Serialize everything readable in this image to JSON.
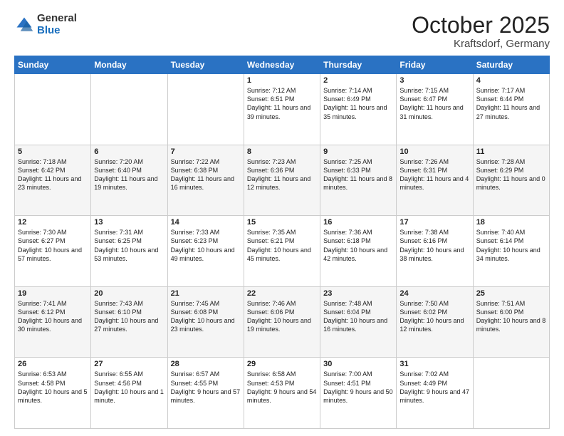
{
  "header": {
    "logo_general": "General",
    "logo_blue": "Blue",
    "month_title": "October 2025",
    "location": "Kraftsdorf, Germany"
  },
  "days_of_week": [
    "Sunday",
    "Monday",
    "Tuesday",
    "Wednesday",
    "Thursday",
    "Friday",
    "Saturday"
  ],
  "weeks": [
    [
      {
        "day": "",
        "sunrise": "",
        "sunset": "",
        "daylight": ""
      },
      {
        "day": "",
        "sunrise": "",
        "sunset": "",
        "daylight": ""
      },
      {
        "day": "",
        "sunrise": "",
        "sunset": "",
        "daylight": ""
      },
      {
        "day": "1",
        "sunrise": "Sunrise: 7:12 AM",
        "sunset": "Sunset: 6:51 PM",
        "daylight": "Daylight: 11 hours and 39 minutes."
      },
      {
        "day": "2",
        "sunrise": "Sunrise: 7:14 AM",
        "sunset": "Sunset: 6:49 PM",
        "daylight": "Daylight: 11 hours and 35 minutes."
      },
      {
        "day": "3",
        "sunrise": "Sunrise: 7:15 AM",
        "sunset": "Sunset: 6:47 PM",
        "daylight": "Daylight: 11 hours and 31 minutes."
      },
      {
        "day": "4",
        "sunrise": "Sunrise: 7:17 AM",
        "sunset": "Sunset: 6:44 PM",
        "daylight": "Daylight: 11 hours and 27 minutes."
      }
    ],
    [
      {
        "day": "5",
        "sunrise": "Sunrise: 7:18 AM",
        "sunset": "Sunset: 6:42 PM",
        "daylight": "Daylight: 11 hours and 23 minutes."
      },
      {
        "day": "6",
        "sunrise": "Sunrise: 7:20 AM",
        "sunset": "Sunset: 6:40 PM",
        "daylight": "Daylight: 11 hours and 19 minutes."
      },
      {
        "day": "7",
        "sunrise": "Sunrise: 7:22 AM",
        "sunset": "Sunset: 6:38 PM",
        "daylight": "Daylight: 11 hours and 16 minutes."
      },
      {
        "day": "8",
        "sunrise": "Sunrise: 7:23 AM",
        "sunset": "Sunset: 6:36 PM",
        "daylight": "Daylight: 11 hours and 12 minutes."
      },
      {
        "day": "9",
        "sunrise": "Sunrise: 7:25 AM",
        "sunset": "Sunset: 6:33 PM",
        "daylight": "Daylight: 11 hours and 8 minutes."
      },
      {
        "day": "10",
        "sunrise": "Sunrise: 7:26 AM",
        "sunset": "Sunset: 6:31 PM",
        "daylight": "Daylight: 11 hours and 4 minutes."
      },
      {
        "day": "11",
        "sunrise": "Sunrise: 7:28 AM",
        "sunset": "Sunset: 6:29 PM",
        "daylight": "Daylight: 11 hours and 0 minutes."
      }
    ],
    [
      {
        "day": "12",
        "sunrise": "Sunrise: 7:30 AM",
        "sunset": "Sunset: 6:27 PM",
        "daylight": "Daylight: 10 hours and 57 minutes."
      },
      {
        "day": "13",
        "sunrise": "Sunrise: 7:31 AM",
        "sunset": "Sunset: 6:25 PM",
        "daylight": "Daylight: 10 hours and 53 minutes."
      },
      {
        "day": "14",
        "sunrise": "Sunrise: 7:33 AM",
        "sunset": "Sunset: 6:23 PM",
        "daylight": "Daylight: 10 hours and 49 minutes."
      },
      {
        "day": "15",
        "sunrise": "Sunrise: 7:35 AM",
        "sunset": "Sunset: 6:21 PM",
        "daylight": "Daylight: 10 hours and 45 minutes."
      },
      {
        "day": "16",
        "sunrise": "Sunrise: 7:36 AM",
        "sunset": "Sunset: 6:18 PM",
        "daylight": "Daylight: 10 hours and 42 minutes."
      },
      {
        "day": "17",
        "sunrise": "Sunrise: 7:38 AM",
        "sunset": "Sunset: 6:16 PM",
        "daylight": "Daylight: 10 hours and 38 minutes."
      },
      {
        "day": "18",
        "sunrise": "Sunrise: 7:40 AM",
        "sunset": "Sunset: 6:14 PM",
        "daylight": "Daylight: 10 hours and 34 minutes."
      }
    ],
    [
      {
        "day": "19",
        "sunrise": "Sunrise: 7:41 AM",
        "sunset": "Sunset: 6:12 PM",
        "daylight": "Daylight: 10 hours and 30 minutes."
      },
      {
        "day": "20",
        "sunrise": "Sunrise: 7:43 AM",
        "sunset": "Sunset: 6:10 PM",
        "daylight": "Daylight: 10 hours and 27 minutes."
      },
      {
        "day": "21",
        "sunrise": "Sunrise: 7:45 AM",
        "sunset": "Sunset: 6:08 PM",
        "daylight": "Daylight: 10 hours and 23 minutes."
      },
      {
        "day": "22",
        "sunrise": "Sunrise: 7:46 AM",
        "sunset": "Sunset: 6:06 PM",
        "daylight": "Daylight: 10 hours and 19 minutes."
      },
      {
        "day": "23",
        "sunrise": "Sunrise: 7:48 AM",
        "sunset": "Sunset: 6:04 PM",
        "daylight": "Daylight: 10 hours and 16 minutes."
      },
      {
        "day": "24",
        "sunrise": "Sunrise: 7:50 AM",
        "sunset": "Sunset: 6:02 PM",
        "daylight": "Daylight: 10 hours and 12 minutes."
      },
      {
        "day": "25",
        "sunrise": "Sunrise: 7:51 AM",
        "sunset": "Sunset: 6:00 PM",
        "daylight": "Daylight: 10 hours and 8 minutes."
      }
    ],
    [
      {
        "day": "26",
        "sunrise": "Sunrise: 6:53 AM",
        "sunset": "Sunset: 4:58 PM",
        "daylight": "Daylight: 10 hours and 5 minutes."
      },
      {
        "day": "27",
        "sunrise": "Sunrise: 6:55 AM",
        "sunset": "Sunset: 4:56 PM",
        "daylight": "Daylight: 10 hours and 1 minute."
      },
      {
        "day": "28",
        "sunrise": "Sunrise: 6:57 AM",
        "sunset": "Sunset: 4:55 PM",
        "daylight": "Daylight: 9 hours and 57 minutes."
      },
      {
        "day": "29",
        "sunrise": "Sunrise: 6:58 AM",
        "sunset": "Sunset: 4:53 PM",
        "daylight": "Daylight: 9 hours and 54 minutes."
      },
      {
        "day": "30",
        "sunrise": "Sunrise: 7:00 AM",
        "sunset": "Sunset: 4:51 PM",
        "daylight": "Daylight: 9 hours and 50 minutes."
      },
      {
        "day": "31",
        "sunrise": "Sunrise: 7:02 AM",
        "sunset": "Sunset: 4:49 PM",
        "daylight": "Daylight: 9 hours and 47 minutes."
      },
      {
        "day": "",
        "sunrise": "",
        "sunset": "",
        "daylight": ""
      }
    ]
  ]
}
